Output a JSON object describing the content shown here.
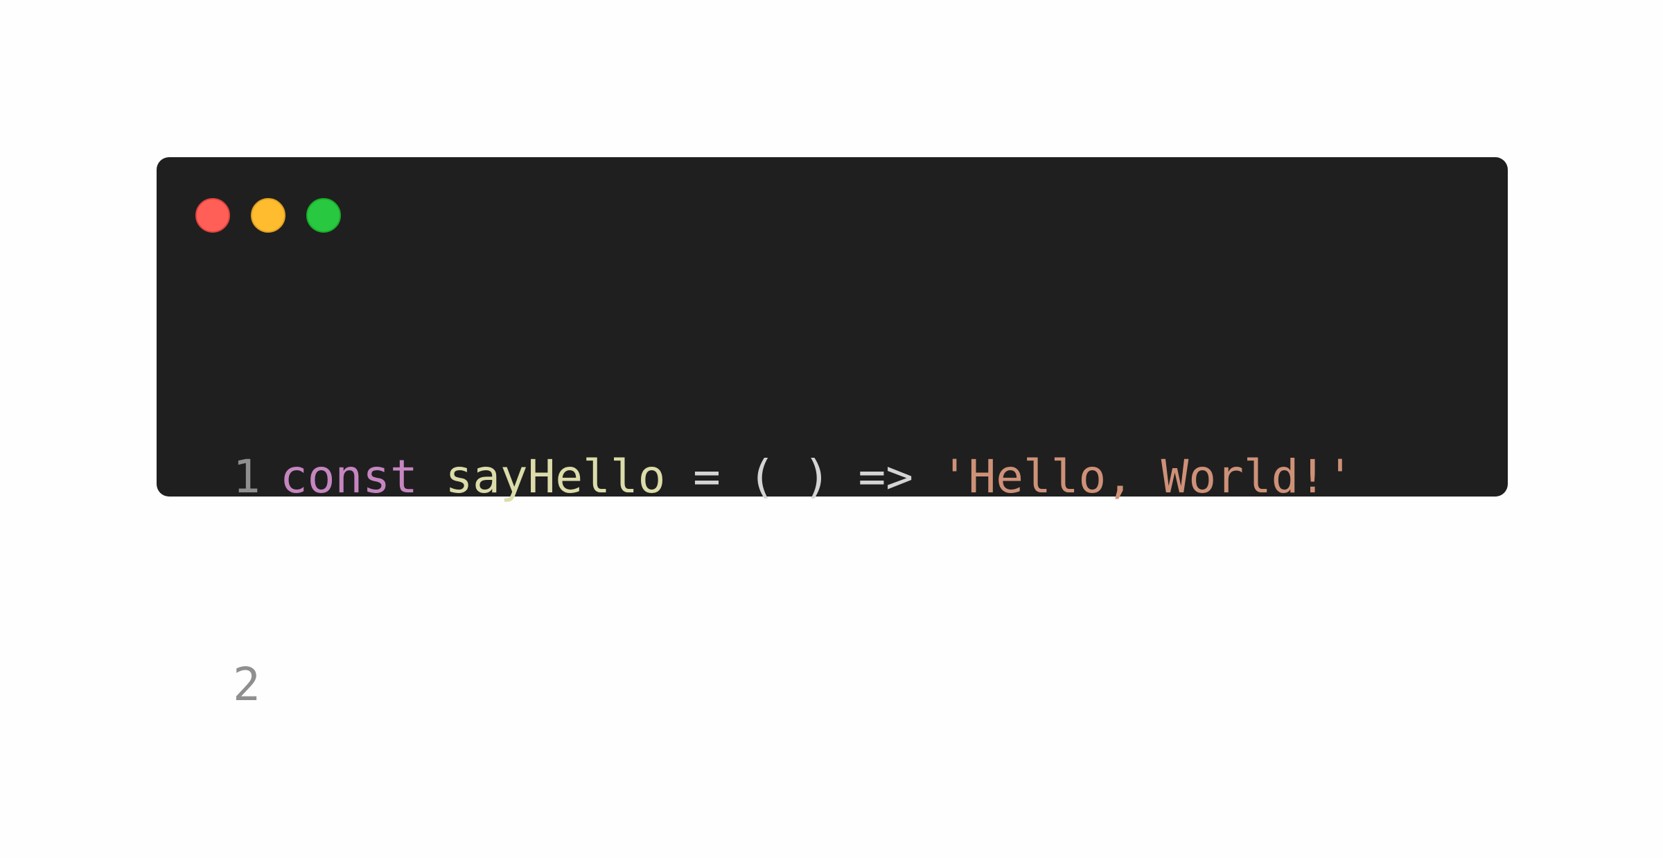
{
  "window": {
    "controls": {
      "close_color": "#ff5f57",
      "minimize_color": "#febc2e",
      "maximize_color": "#28c840"
    }
  },
  "code": {
    "lines": [
      {
        "number": "1",
        "tokens": {
          "keyword": "const",
          "name": "sayHello",
          "assign": "=",
          "parens": "( )",
          "arrow": "=>",
          "string": "'Hello, World!'"
        }
      },
      {
        "number": "2"
      }
    ],
    "colors": {
      "keyword": "#c586c0",
      "function": "#dcdcaa",
      "punctuation": "#d4d4d4",
      "string": "#ce9178",
      "line_number": "#8f8f8f",
      "background": "#1f1f1f"
    }
  }
}
